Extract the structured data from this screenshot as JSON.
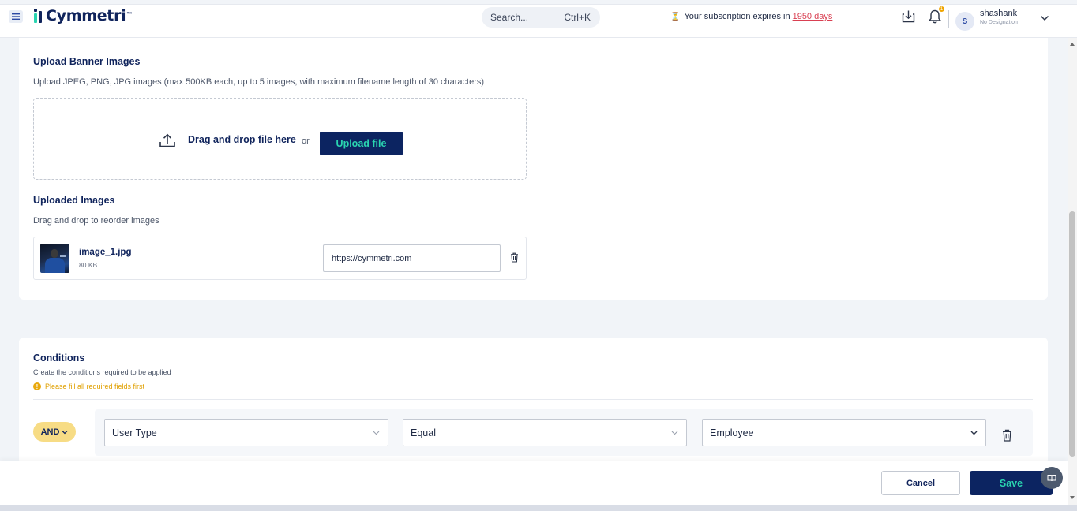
{
  "header": {
    "brand": "Cymmetri",
    "brand_tm": "™",
    "search_placeholder": "Search...",
    "search_shortcut": "Ctrl+K",
    "subscription_prefix": "Your subscription expires in",
    "subscription_days": "1950 days",
    "notification_count": "1",
    "user_initial": "S",
    "user_name": "shashank",
    "user_designation": "No Designation"
  },
  "banner": {
    "title": "Upload Banner Images",
    "description": "Upload JPEG, PNG, JPG images (max 500KB each, up to 5 images, with maximum filename length of 30 characters)",
    "dropzone_text": "Drag and drop file here",
    "or_text": "or",
    "upload_button": "Upload file"
  },
  "uploaded": {
    "title": "Uploaded Images",
    "description": "Drag and drop to reorder images",
    "items": [
      {
        "name": "image_1.jpg",
        "size": "80 KB",
        "url": "https://cymmetri.com"
      }
    ]
  },
  "conditions": {
    "title": "Conditions",
    "description": "Create the conditions required to be applied",
    "warning": "Please fill all required fields first",
    "operator": "AND",
    "rows": [
      {
        "field": "User Type",
        "comparator": "Equal",
        "value": "Employee"
      }
    ]
  },
  "footer": {
    "cancel_label": "Cancel",
    "save_label": "Save"
  },
  "colors": {
    "primary": "#0c2461",
    "accent": "#2ad4b0",
    "warning": "#e9a90d",
    "link_red": "#d94052",
    "operator_pill": "#f7dc85"
  }
}
